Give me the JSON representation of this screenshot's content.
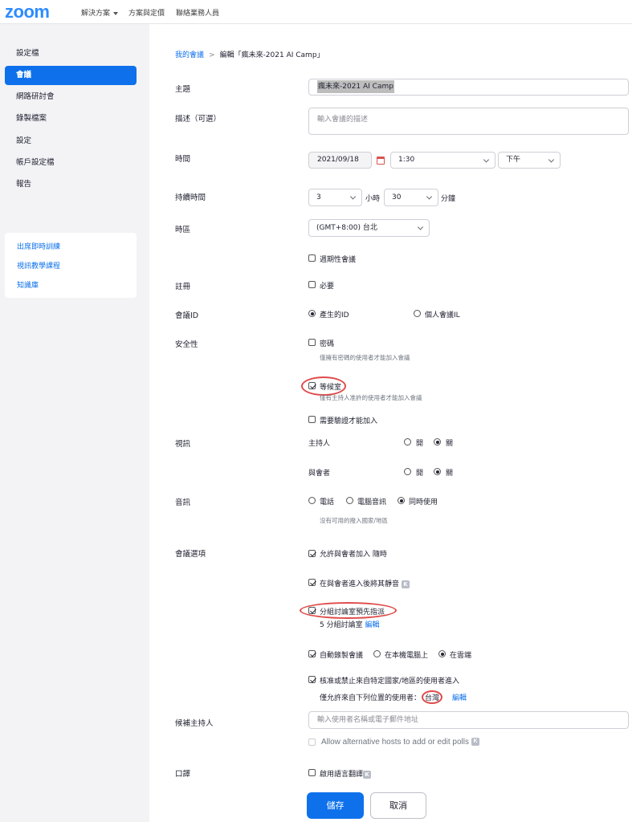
{
  "topbar": {
    "logo": "zoom",
    "nav": [
      "解決方案",
      "方案與定價",
      "聯絡業務人員"
    ]
  },
  "sidebar": {
    "items": [
      "設定檔",
      "會議",
      "網路研討會",
      "錄製檔案",
      "設定",
      "帳戶設定檔",
      "報告"
    ],
    "active_index": 1,
    "links": [
      "出席即時訓練",
      "視訊教學課程",
      "知識庫"
    ]
  },
  "breadcrumb": {
    "link": "我的會議",
    "separator": ">",
    "current": "編輯「瘋未來-2021 AI Camp」"
  },
  "form": {
    "topic": {
      "label": "主題",
      "value": "瘋未來-2021 AI Camp"
    },
    "description": {
      "label": "描述（可選）",
      "placeholder": "輸入會議的描述"
    },
    "time": {
      "label": "時間",
      "date": "2021/09/18",
      "time": "1:30",
      "ampm": "下午"
    },
    "duration": {
      "label": "持續時間",
      "hours": "3",
      "hours_unit": "小時",
      "minutes": "30",
      "minutes_unit": "分鐘"
    },
    "timezone": {
      "label": "時區",
      "value": "(GMT+8:00) 台北"
    },
    "recurring": {
      "label": "週期性會議",
      "checked": false
    },
    "registration": {
      "label": "註冊",
      "option": "必要",
      "checked": false
    },
    "meeting_id": {
      "label": "會議ID",
      "option_generated": "產生的ID",
      "option_personal": "個人會議IL",
      "selected": "generated"
    },
    "security": {
      "label": "安全性",
      "passcode": "密碼",
      "passcode_hint": "僅擁有密碼的使用者才能加入會議",
      "waiting_room": "等候室",
      "waiting_room_hint": "僅有主持人准許的使用者才能加入會議",
      "auth": "需要驗證才能加入"
    },
    "video": {
      "label": "視訊",
      "host": "主持人",
      "participants": "與會者",
      "on": "開",
      "off": "關"
    },
    "audio": {
      "label": "音訊",
      "telephone": "電話",
      "computer": "電腦音訊",
      "both": "同時使用",
      "hint": "沒有可用的撥入國家/地區"
    },
    "options": {
      "label": "會議選項",
      "join_anytime": "允許與會者加入 隨時",
      "mute_on_entry": "在與會者進入後將其靜音",
      "breakout": "分組討論室預先指派",
      "breakout_info": "5 分組討論室",
      "edit": "編輯",
      "auto_record": "自動錄製會議",
      "record_local": "在本機電腦上",
      "record_cloud": "在雲端",
      "region": "核准或禁止來自特定國家/地區的使用者進入",
      "region_info": "僅允許來自下列位置的使用者：",
      "region_value": "台灣",
      "badge": "K"
    },
    "alt_hosts": {
      "label": "候補主持人",
      "placeholder": "輸入使用者名稱或電子郵件地址",
      "polls": "Allow alternative hosts to add or edit polls"
    },
    "interpretation": {
      "label": "口譯",
      "option": "啟用語言翻譯"
    }
  },
  "buttons": {
    "save": "儲存",
    "cancel": "取消"
  },
  "colors": {
    "brand": "#2D8CFF",
    "primary": "#0E71EB",
    "highlight": "#e04a4a"
  }
}
